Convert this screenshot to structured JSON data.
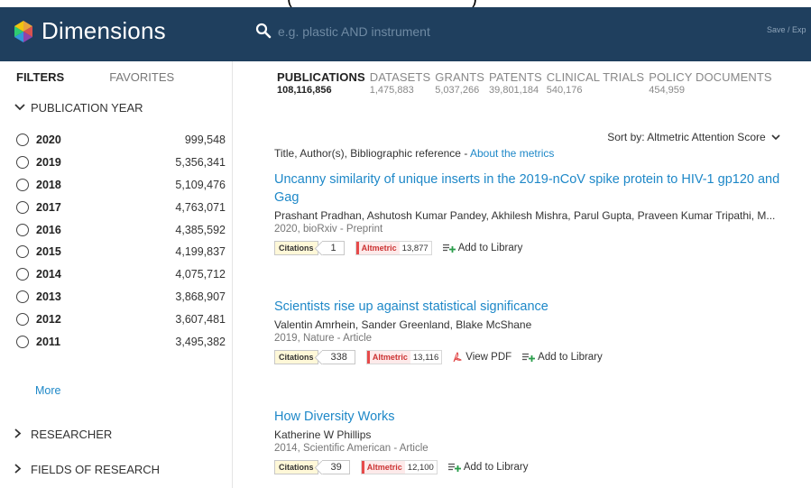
{
  "header": {
    "clipped_top_text": "(                              )",
    "logo_text": "Dimensions",
    "search_placeholder": "e.g. plastic AND instrument",
    "save_export": "Save / Exp"
  },
  "sidebar": {
    "tabs": [
      {
        "label": "FILTERS",
        "active": true
      },
      {
        "label": "FAVORITES",
        "active": false
      }
    ],
    "publication_year": {
      "label": "PUBLICATION YEAR",
      "items": [
        {
          "year": "2020",
          "count": "999,548"
        },
        {
          "year": "2019",
          "count": "5,356,341"
        },
        {
          "year": "2018",
          "count": "5,109,476"
        },
        {
          "year": "2017",
          "count": "4,763,071"
        },
        {
          "year": "2016",
          "count": "4,385,592"
        },
        {
          "year": "2015",
          "count": "4,199,837"
        },
        {
          "year": "2014",
          "count": "4,075,712"
        },
        {
          "year": "2013",
          "count": "3,868,907"
        },
        {
          "year": "2012",
          "count": "3,607,481"
        },
        {
          "year": "2011",
          "count": "3,495,382"
        }
      ],
      "more_label": "More"
    },
    "researcher_label": "RESEARCHER",
    "fields_label": "FIELDS OF RESEARCH"
  },
  "main": {
    "tabs": [
      {
        "label": "PUBLICATIONS",
        "count": "108,116,856",
        "active": true
      },
      {
        "label": "DATASETS",
        "count": "1,475,883",
        "active": false
      },
      {
        "label": "GRANTS",
        "count": "5,037,266",
        "active": false
      },
      {
        "label": "PATENTS",
        "count": "39,801,184",
        "active": false
      },
      {
        "label": "CLINICAL TRIALS",
        "count": "540,176",
        "active": false
      },
      {
        "label": "POLICY DOCUMENTS",
        "count": "454,959",
        "active": false
      }
    ],
    "sort_label": "Sort by:",
    "sort_value": "Altmetric Attention Score",
    "meta_text": "Title, Author(s), Bibliographic reference - ",
    "meta_link": "About the metrics",
    "results": [
      {
        "title": "Uncanny similarity of unique inserts in the 2019-nCoV spike protein to HIV-1 gp120 and Gag",
        "authors": "Prashant Pradhan, Ashutosh Kumar Pandey, Akhilesh Mishra, Parul Gupta, Praveen Kumar Tripathi, M...",
        "source": "2020, bioRxiv - Preprint",
        "citations_label": "Citations",
        "citations": "1",
        "altmetric_label": "Altmetric",
        "altmetric": "13,877",
        "add_library": "Add to Library"
      },
      {
        "title": "Scientists rise up against statistical significance",
        "authors": "Valentin Amrhein, Sander Greenland, Blake McShane",
        "source": "2019, Nature - Article",
        "citations_label": "Citations",
        "citations": "338",
        "altmetric_label": "Altmetric",
        "altmetric": "13,116",
        "view_pdf": "View PDF",
        "add_library": "Add to Library"
      },
      {
        "title": "How Diversity Works",
        "authors": "Katherine W Phillips",
        "source": "2014, Scientific American - Article",
        "citations_label": "Citations",
        "citations": "39",
        "altmetric_label": "Altmetric",
        "altmetric": "12,100",
        "add_library": "Add to Library"
      }
    ]
  },
  "colors": {
    "header_bg": "#1f3f5e",
    "link": "#1e88c8",
    "altmetric_red": "#e64a4a",
    "citations_green": "#2a9d4b"
  }
}
